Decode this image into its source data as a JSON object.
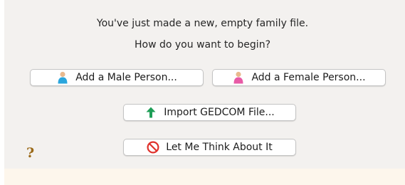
{
  "message": {
    "line1": "You've just made a new, empty family file.",
    "line2": "How do you want to begin?"
  },
  "buttons": {
    "male": {
      "label": "Add a Male Person...",
      "icon": "male-person-icon",
      "color": "#2aa6dd"
    },
    "female": {
      "label": "Add a Female Person...",
      "icon": "female-person-icon",
      "color": "#e85aa6"
    },
    "gedcom": {
      "label": "Import GEDCOM File...",
      "icon": "green-up-arrow-icon",
      "color": "#1e9e57"
    },
    "think": {
      "label": "Let Me Think About It",
      "icon": "prohibited-icon",
      "color": "#e0312b"
    }
  },
  "help": {
    "label": "?"
  }
}
